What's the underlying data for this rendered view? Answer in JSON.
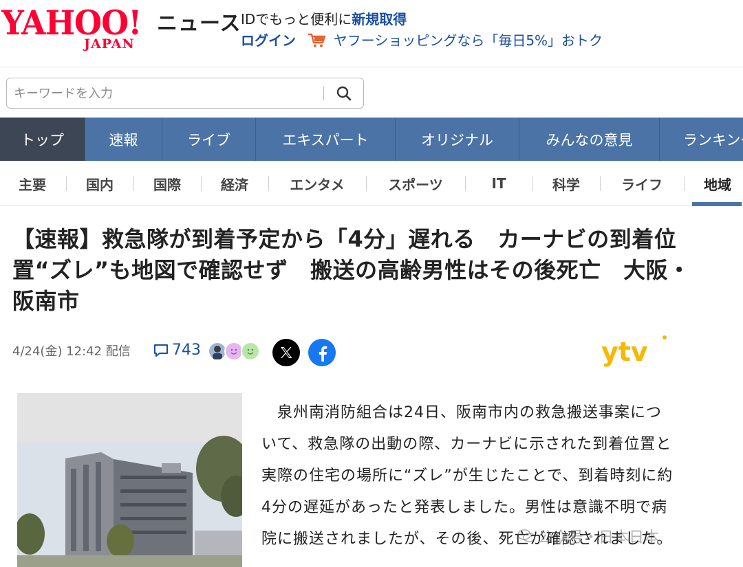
{
  "header": {
    "logo_yahoo": "YAHOO!",
    "logo_japan": "JAPAN",
    "news": "ニュース",
    "promo_text": "IDでもっと便利に",
    "promo_link": "新規取得",
    "login": "ログイン",
    "shopping": "ヤフーショッピングなら「毎日5%」おトク"
  },
  "search": {
    "placeholder": "キーワードを入力"
  },
  "main_nav": [
    {
      "label": "トップ",
      "active": true
    },
    {
      "label": "速報"
    },
    {
      "label": "ライブ"
    },
    {
      "label": "エキスパート"
    },
    {
      "label": "オリジナル"
    },
    {
      "label": "みんなの意見"
    },
    {
      "label": "ランキング"
    }
  ],
  "sub_nav": [
    {
      "label": "主要"
    },
    {
      "label": "国内"
    },
    {
      "label": "国際"
    },
    {
      "label": "経済"
    },
    {
      "label": "エンタメ"
    },
    {
      "label": "スポーツ"
    },
    {
      "label": "IT"
    },
    {
      "label": "科学"
    },
    {
      "label": "ライフ"
    },
    {
      "label": "地域",
      "active": true
    }
  ],
  "article": {
    "title_line1": "【速報】救急隊が到着予定から「4分」遅れる　カーナビの到着位",
    "title_line2": "置“ズレ”も地図で確認せず　搬送の高齢男性はその後死亡　大阪・",
    "title_line3": "阪南市",
    "date": "4/24(金) 12:42 配信",
    "comment_count": "743",
    "source_logo": "ytv",
    "body_lines": [
      "　泉州南消防組合は24日、阪南市内の救急搬送事案につ",
      "いて、救急隊の出動の際、カーナビに示された到着位置と",
      "実際の住宅の場所に“ズレ”が生じたことで、到着時刻に約",
      "4分の遅延があったと発表しました。男性は意識不明で病",
      "院に搬送されましたが、その後、死亡が確認されました。"
    ],
    "watermark": "公众号・日本日本"
  },
  "colors": {
    "yahoo_red": "#ff0033",
    "nav_blue": "#4b73a6",
    "nav_active": "#3d4654",
    "link_blue": "#1a4fa3",
    "ytv_yellow": "#f6b800"
  }
}
